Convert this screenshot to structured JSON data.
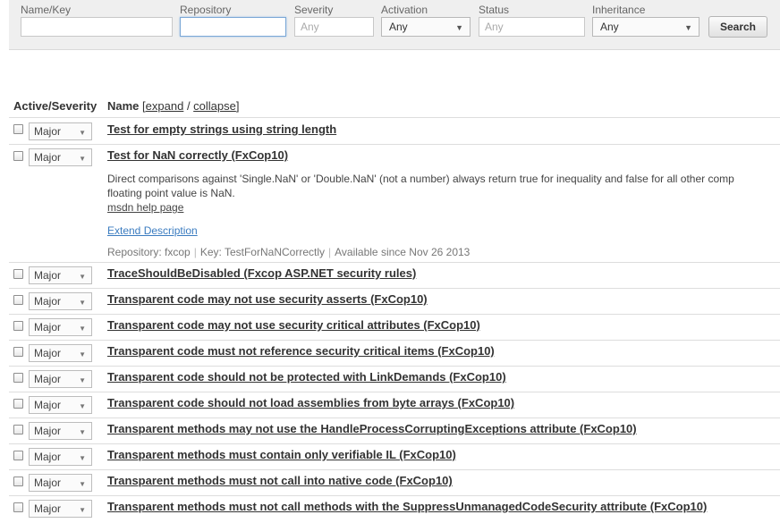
{
  "filters": {
    "name_key_label": "Name/Key",
    "name_key_value": "",
    "repository_label": "Repository",
    "repository_value": "",
    "severity_label": "Severity",
    "severity_placeholder": "Any",
    "activation_label": "Activation",
    "activation_value": "Any",
    "status_label": "Status",
    "status_placeholder": "Any",
    "inheritance_label": "Inheritance",
    "inheritance_value": "Any",
    "search_label": "Search"
  },
  "table": {
    "col_active_severity": "Active/Severity",
    "col_name": "Name",
    "expand_label": "expand",
    "collapse_label": "collapse"
  },
  "rules": [
    {
      "severity": "Major",
      "name": "Test for empty strings using string length"
    },
    {
      "severity": "Major",
      "name": "Test for NaN correctly (FxCop10)",
      "description_line1": "Direct comparisons against 'Single.NaN' or 'Double.NaN' (not a number) always return true for inequality and false for all other comp",
      "description_line2": "floating point value is NaN.",
      "help_link": "msdn help page",
      "extend_link": "Extend Description",
      "repository": "Repository: fxcop",
      "key": "Key: TestForNaNCorrectly",
      "available": "Available since Nov 26 2013"
    },
    {
      "severity": "Major",
      "name": "TraceShouldBeDisabled (Fxcop ASP.NET security rules)"
    },
    {
      "severity": "Major",
      "name": "Transparent code may not use security asserts (FxCop10)"
    },
    {
      "severity": "Major",
      "name": "Transparent code may not use security critical attributes (FxCop10)"
    },
    {
      "severity": "Major",
      "name": "Transparent code must not reference security critical items (FxCop10)"
    },
    {
      "severity": "Major",
      "name": "Transparent code should not be protected with LinkDemands (FxCop10)"
    },
    {
      "severity": "Major",
      "name": "Transparent code should not load assemblies from byte arrays (FxCop10)"
    },
    {
      "severity": "Major",
      "name": "Transparent methods may not use the HandleProcessCorruptingExceptions attribute (FxCop10)"
    },
    {
      "severity": "Major",
      "name": "Transparent methods must contain only verifiable IL (FxCop10)"
    },
    {
      "severity": "Major",
      "name": "Transparent methods must not call into native code (FxCop10)"
    },
    {
      "severity": "Major",
      "name": "Transparent methods must not call methods with the SuppressUnmanagedCodeSecurity attribute (FxCop10)"
    }
  ]
}
